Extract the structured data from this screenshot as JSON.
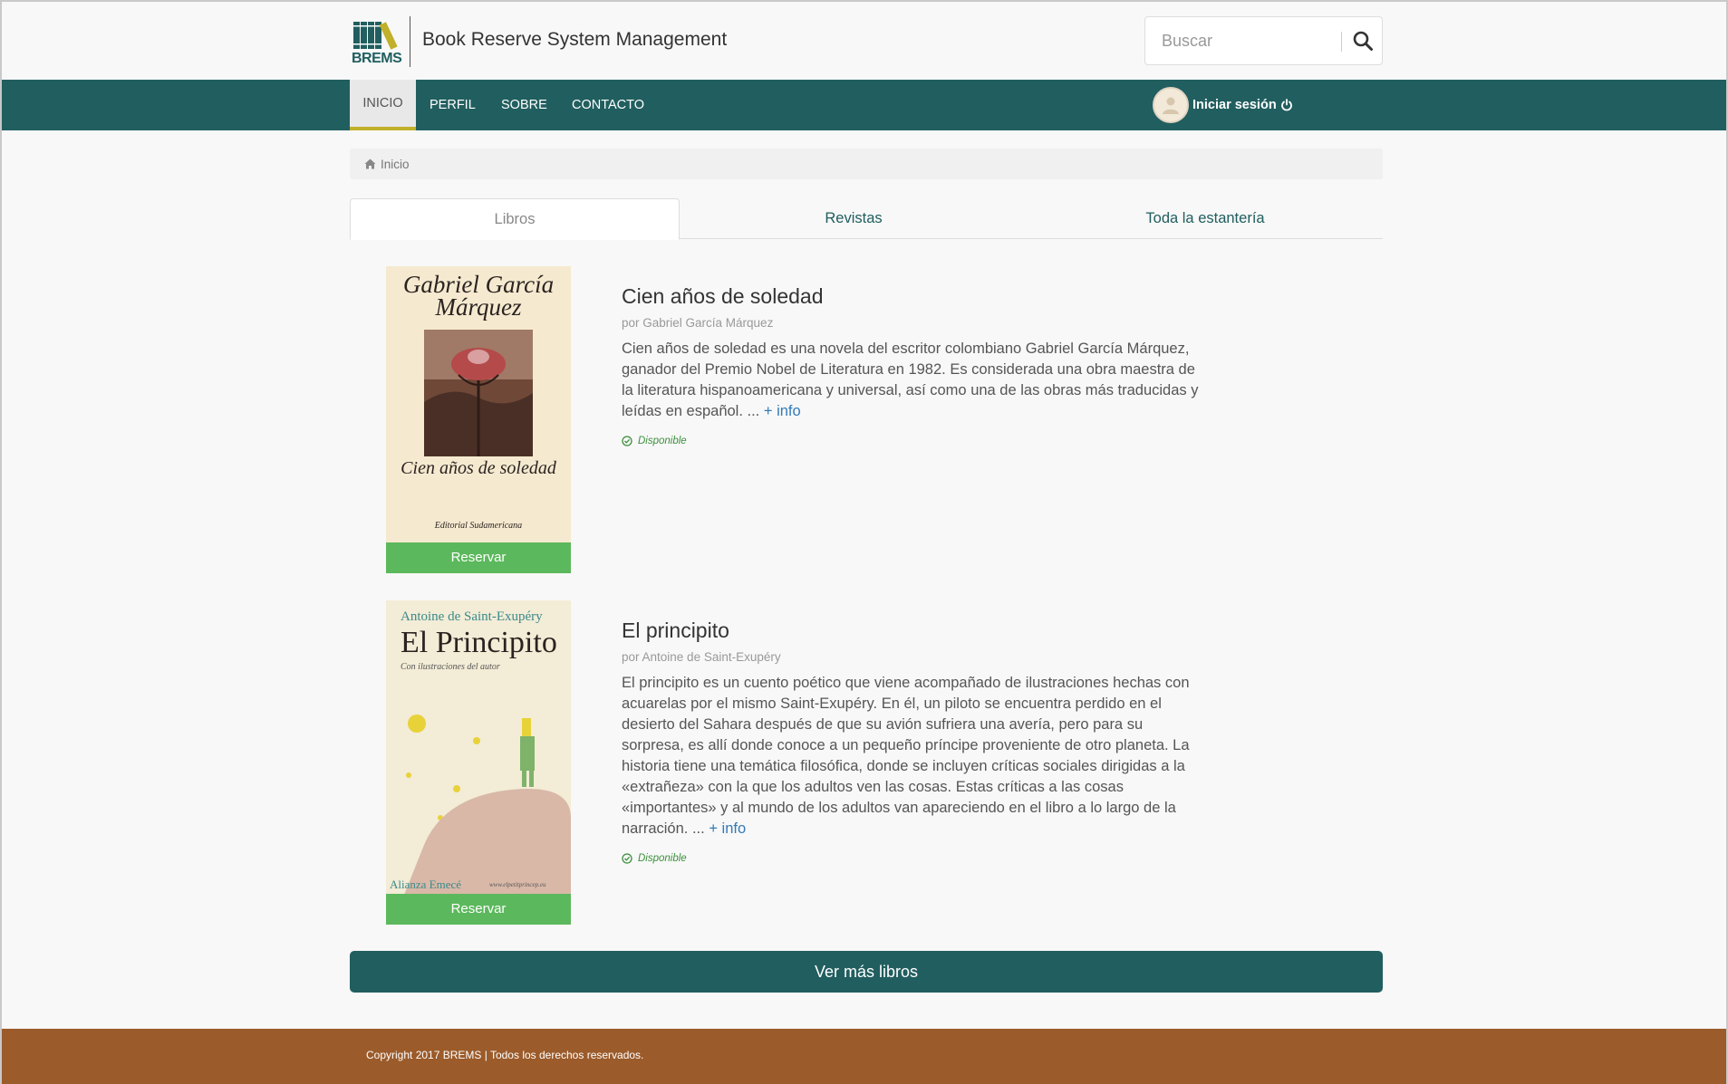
{
  "brand": {
    "logo_text": "BREMS",
    "title": "Book Reserve System Management"
  },
  "search": {
    "placeholder": "Buscar"
  },
  "nav": {
    "items": [
      "INICIO",
      "PERFIL",
      "SOBRE",
      "CONTACTO"
    ],
    "login_label": "Iniciar sesión"
  },
  "breadcrumb": {
    "home": "Inicio"
  },
  "tabs": [
    "Libros",
    "Revistas",
    "Toda la estantería"
  ],
  "books": [
    {
      "cover_author": "Gabriel García Márquez",
      "cover_title": "Cien años de soledad",
      "cover_publisher": "Editorial Sudamericana",
      "title": "Cien años de soledad",
      "author": "por Gabriel García Márquez",
      "description": "Cien años de soledad es una novela del escritor colombiano Gabriel García Márquez, ganador del Premio Nobel de Literatura en 1982. Es considerada una obra maestra de la literatura hispanoamericana y universal, así como una de las obras más traducidas y leídas en español. ...",
      "more": "+ info",
      "status": "Disponible",
      "reserve": "Reservar"
    },
    {
      "cover_author": "Antoine de Saint-Exupéry",
      "cover_title": "El Principito",
      "cover_subtitle": "Con ilustraciones del autor",
      "cover_publisher": "Alianza Emecé",
      "cover_url": "www.elpetitprincep.eu",
      "title": "El principito",
      "author": "por Antoine de Saint-Exupéry",
      "description": "El principito es un cuento poético que viene acompañado de ilustraciones hechas con acuarelas por el mismo Saint-Exupéry. En él, un piloto se encuentra perdido en el desierto del Sahara después de que su avión sufriera una avería, pero para su sorpresa, es allí donde conoce a un pequeño príncipe proveniente de otro planeta. La historia tiene una temática filosófica, donde se incluyen críticas sociales dirigidas a la «extrañeza» con la que los adultos ven las cosas. Estas críticas a las cosas «importantes» y al mundo de los adultos van apareciendo en el libro a lo largo de la narración. ...",
      "more": "+ info",
      "status": "Disponible",
      "reserve": "Reservar"
    }
  ],
  "more_books": "Ver más libros",
  "footer": {
    "copyright": "Copyright 2017 BREMS | Todos los derechos reservados."
  },
  "colors": {
    "primary": "#215e5f",
    "success": "#5cb85c",
    "footer": "#9b5b2a",
    "accent": "#c1b02a",
    "link": "#337ab7"
  }
}
